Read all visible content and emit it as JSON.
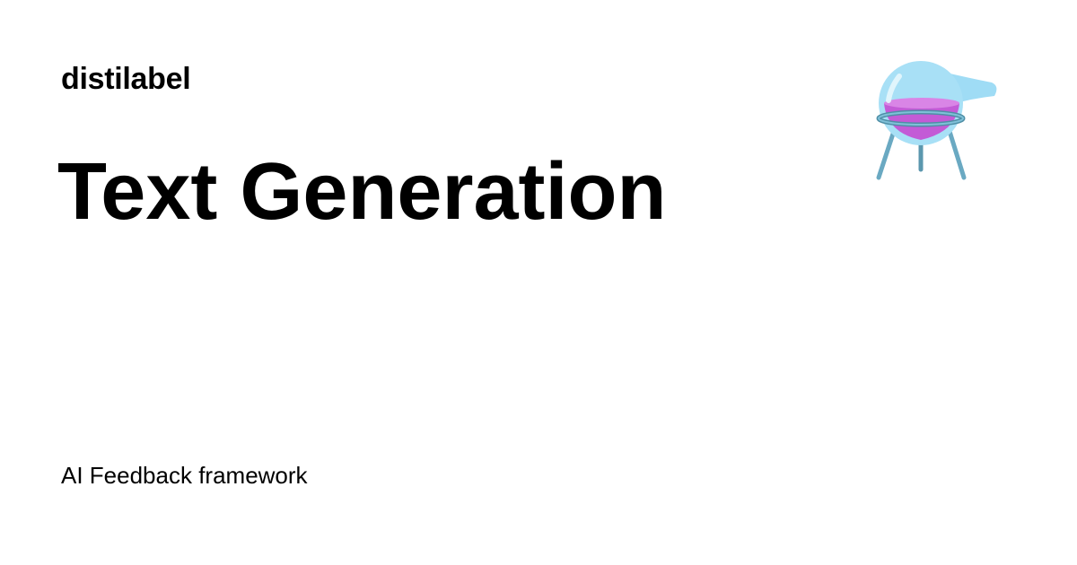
{
  "site": {
    "name": "distilabel",
    "logo_icon": "flask-icon"
  },
  "page": {
    "title": "Text Generation",
    "tagline": "AI Feedback framework"
  },
  "colors": {
    "background": "#ffffff",
    "text": "#000000",
    "flask_glass": "#9fdcf5",
    "flask_liquid": "#c35bd6",
    "stand": "#6aa9c2"
  }
}
